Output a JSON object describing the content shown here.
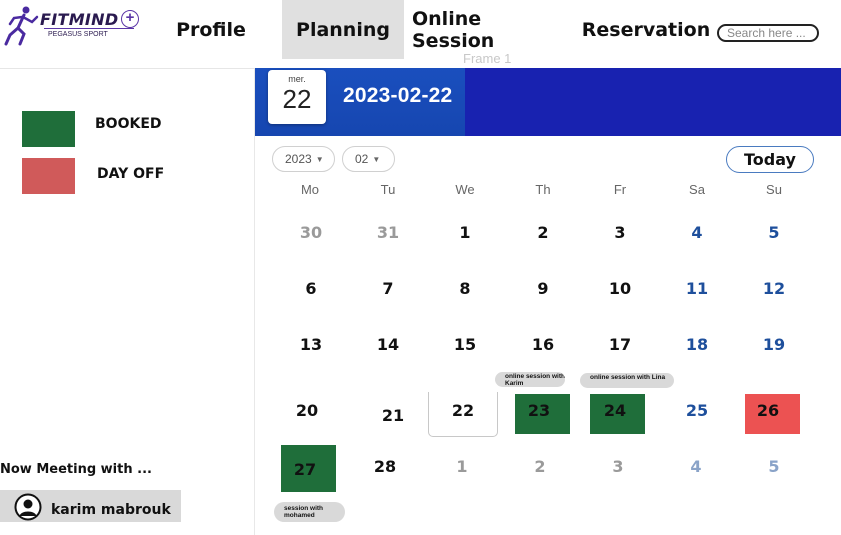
{
  "brand": {
    "name": "FITMIND",
    "tagline": "PEGASUS SPORT"
  },
  "nav": {
    "items": [
      "Profile",
      "Planning",
      "Online Session",
      "Reservation"
    ],
    "active": "Planning"
  },
  "search": {
    "placeholder": "Search here ..."
  },
  "frame_label": "Frame 1",
  "legend": {
    "booked": {
      "label": "BOOKED",
      "color": "#1f6e3a"
    },
    "day_off": {
      "label": "DAY OFF",
      "color": "#d05a5a"
    }
  },
  "meeting": {
    "title": "Now Meeting with ...",
    "user": "karim mabrouk"
  },
  "calendar": {
    "selected_weekday": "mer.",
    "selected_day": "22",
    "selected_date": "2023-02-22",
    "year": "2023",
    "month": "02",
    "today_label": "Today",
    "weekdays": [
      "Mo",
      "Tu",
      "We",
      "Th",
      "Fr",
      "Sa",
      "Su"
    ],
    "weeks": [
      [
        "30",
        "31",
        "1",
        "2",
        "3",
        "4",
        "5"
      ],
      [
        "6",
        "7",
        "8",
        "9",
        "10",
        "11",
        "12"
      ],
      [
        "13",
        "14",
        "15",
        "16",
        "17",
        "18",
        "19"
      ],
      [
        "20",
        "21",
        "22",
        "23",
        "24",
        "25",
        "26"
      ],
      [
        "27",
        "28",
        "1",
        "2",
        "3",
        "4",
        "5"
      ]
    ],
    "sessions": {
      "karim": "online session with Karim",
      "lina": "online session with Lina",
      "mohamed": "session with mohamed"
    },
    "colors": {
      "header": "#1822b0",
      "booked": "#1f6e3a",
      "day_off": "#ec5252"
    }
  }
}
